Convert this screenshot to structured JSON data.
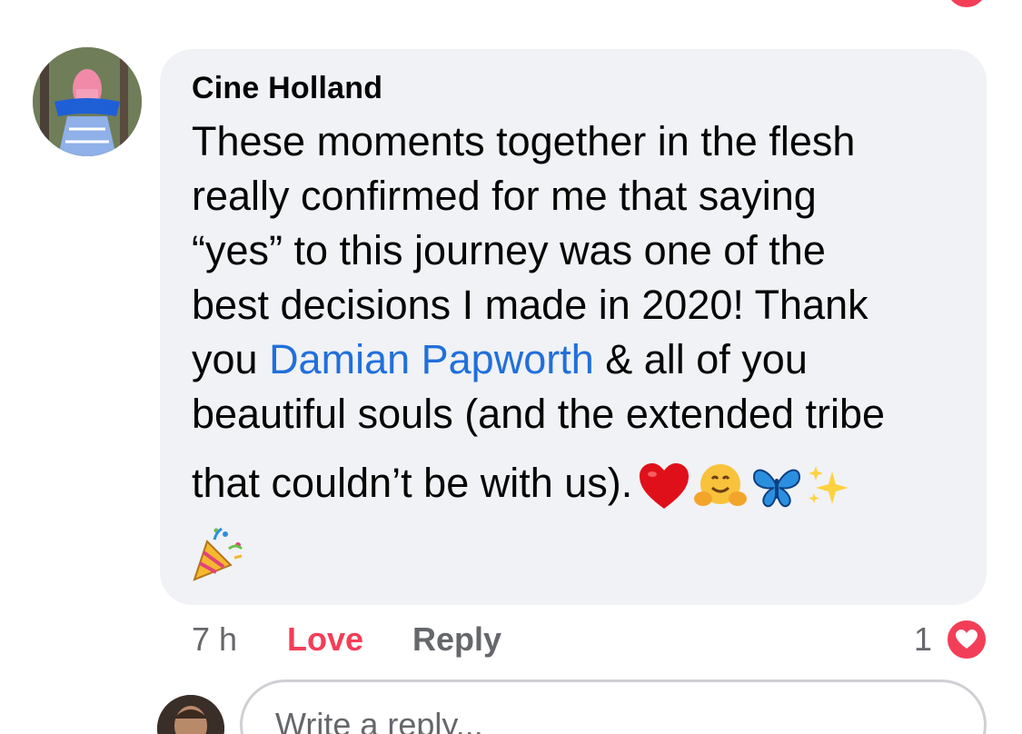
{
  "comment": {
    "author": "Cine Holland",
    "text_lines": [
      "These moments together in the flesh",
      "really confirmed for me that saying",
      "“yes” to this journey was one of the",
      "best decisions I made in 2020! Thank"
    ],
    "line5_prefix": "you ",
    "mention": "Damian Papworth",
    "line5_suffix": " & all of you",
    "line6": "beautiful souls (and the extended tribe",
    "line7": "that couldn’t be with us).",
    "emojis": [
      "red-heart",
      "hugging-face",
      "butterfly",
      "sparkles",
      "party-popper"
    ]
  },
  "actions": {
    "time": "7 h",
    "love_label": "Love",
    "reply_label": "Reply",
    "reaction_count": "1"
  },
  "composer": {
    "placeholder": "Write a reply..."
  },
  "colors": {
    "bubble": "#f0f2f5",
    "love": "#f33e58",
    "mention": "#216fdb",
    "secondary_text": "#65676b"
  }
}
